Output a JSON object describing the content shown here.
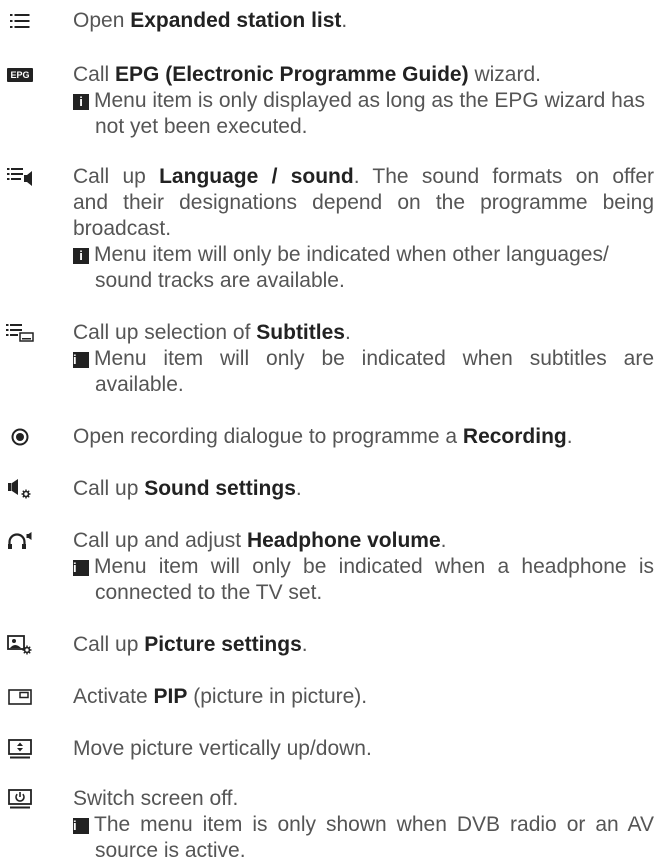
{
  "entries": [
    {
      "icon": "list-icon",
      "pre": "Open ",
      "bold": "Expanded station list",
      "post": "."
    },
    {
      "icon": "epg-icon",
      "icon_text": "EPG",
      "pre": "Call ",
      "bold": "EPG (Electronic Programme Guide)",
      "post": " wizard.",
      "note_l1": "Menu item is only displayed as long as the EPG wizard has",
      "note_l2": "not yet been executed."
    },
    {
      "icon": "language-sound-icon",
      "pre": "Call up ",
      "bold": "Language / sound",
      "post_l1": ". The sound formats on offer",
      "l2": "and their designations depend on the programme being",
      "l3": "broadcast.",
      "note_l1": "Menu item will only be indicated when other languages/",
      "note_l2": "sound tracks are available."
    },
    {
      "icon": "subtitles-icon",
      "pre": "Call up selection of ",
      "bold": "Subtitles",
      "post": ".",
      "note_l1": "Menu item will only be indicated when subtitles are",
      "note_l2": "available."
    },
    {
      "icon": "record-icon",
      "pre": "Open recording dialogue to programme a ",
      "bold": "Recording",
      "post": "."
    },
    {
      "icon": "sound-settings-icon",
      "pre": "Call up ",
      "bold": "Sound settings",
      "post": "."
    },
    {
      "icon": "headphone-icon",
      "pre": "Call up and adjust ",
      "bold": "Headphone volume",
      "post": ".",
      "note_l1": "Menu item will only be indicated when a headphone is",
      "note_l2": "connected to the TV set."
    },
    {
      "icon": "picture-settings-icon",
      "pre": "Call up ",
      "bold": "Picture settings",
      "post": "."
    },
    {
      "icon": "pip-icon",
      "pre": "Activate ",
      "bold": "PIP",
      "post": " (picture in picture)."
    },
    {
      "icon": "move-picture-icon",
      "text": "Move picture vertically up/down."
    },
    {
      "icon": "screen-off-icon",
      "text": "Switch screen off.",
      "note_l1": "The menu item is only shown when DVB radio or an AV",
      "note_l2": "source is active."
    }
  ],
  "info_glyph": "i"
}
